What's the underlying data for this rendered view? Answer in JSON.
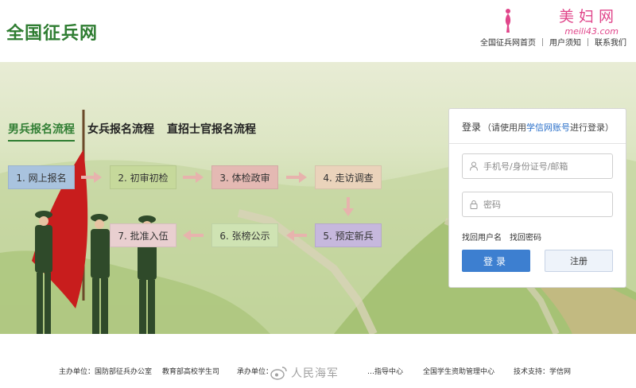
{
  "header": {
    "site_title": "全国征兵网",
    "watermark_title": "美妇网",
    "watermark_url": "meili43.com",
    "links": [
      "全国征兵网首页",
      "用户须知",
      "联系我们"
    ]
  },
  "tabs": [
    "男兵报名流程",
    "女兵报名流程",
    "直招士官报名流程"
  ],
  "active_tab": "男兵报名流程",
  "steps": [
    "1. 网上报名",
    "2. 初审初检",
    "3. 体检政审",
    "4. 走访调查",
    "5. 预定新兵",
    "6. 张榜公示",
    "7. 批准入伍"
  ],
  "login": {
    "title": "登录",
    "hint_prefix": "（请使用用",
    "hint_link": "学信网账号",
    "hint_suffix": "进行登录）",
    "username_placeholder": "手机号/身份证号/邮箱",
    "password_placeholder": "密码",
    "find_username": "找回用户名",
    "find_password": "找回密码",
    "login_button": "登录",
    "register_button": "注册"
  },
  "footer": {
    "sponsor": "主办单位：国防部征兵办公室",
    "sponsor2": "教育部高校学生司",
    "organizer_label": "承办单位：",
    "organizer": "…指导中心",
    "aid_center": "全国学生资助管理中心",
    "tech_support": "技术支持：学信网",
    "weibo_watermark": "人民海军"
  },
  "colors": {
    "brand_green": "#2f7d32",
    "login_blue": "#3d7fd0",
    "watermark_pink": "#e0458a"
  }
}
